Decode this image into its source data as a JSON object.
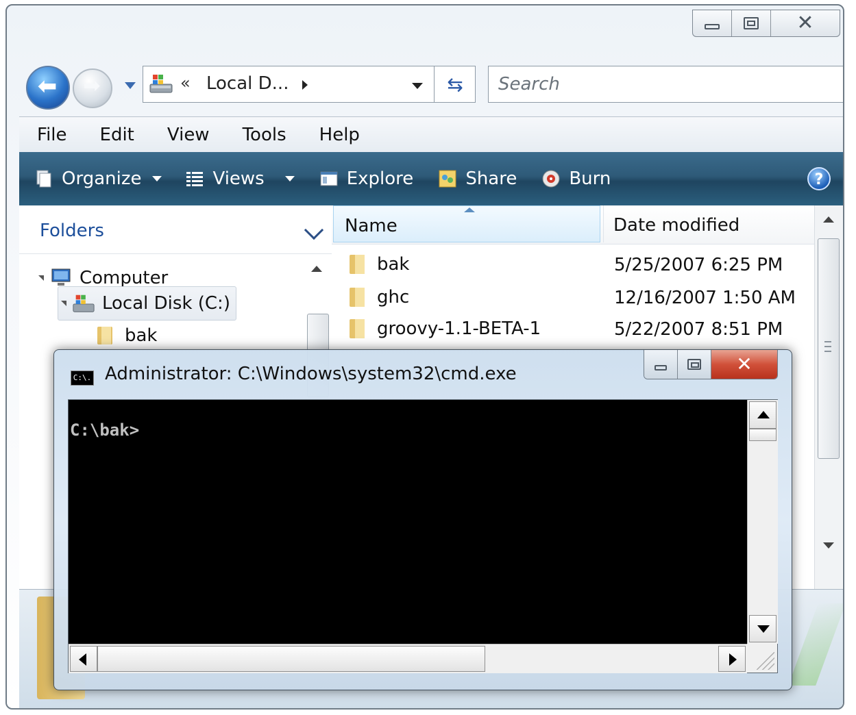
{
  "explorer": {
    "address": {
      "crumb": "Local D...",
      "prefix": "«"
    },
    "search": {
      "placeholder": "Search"
    },
    "menu": [
      "File",
      "Edit",
      "View",
      "Tools",
      "Help"
    ],
    "toolbar": {
      "organize": "Organize",
      "views": "Views",
      "explore": "Explore",
      "share": "Share",
      "burn": "Burn",
      "help": "?"
    },
    "nav": {
      "header": "Folders",
      "tree": [
        {
          "label": "Computer"
        },
        {
          "label": "Local Disk (C:)"
        },
        {
          "label": "bak"
        }
      ]
    },
    "files": {
      "columns": [
        "Name",
        "Date modified"
      ],
      "rows": [
        {
          "name": "bak",
          "date": "5/25/2007 6:25 PM"
        },
        {
          "name": "ghc",
          "date": "12/16/2007 1:50 AM"
        },
        {
          "name": "groovy-1.1-BETA-1",
          "date": "5/22/2007 8:51 PM"
        }
      ]
    }
  },
  "cmd": {
    "title": "Administrator: C:\\Windows\\system32\\cmd.exe",
    "icon_text": "C:\\.",
    "prompt": "C:\\bak>"
  },
  "colors": {
    "command_bar": "#2e5a78",
    "link_blue": "#1d4f9b",
    "console_bg": "#000000",
    "console_fg": "#c0c0c0",
    "close_red": "#c8412a"
  },
  "icons": [
    "back-arrow-icon",
    "forward-arrow-icon",
    "drive-icon",
    "refresh-icon",
    "organize-icon",
    "views-icon",
    "explore-icon",
    "share-icon",
    "burn-icon",
    "help-icon",
    "computer-icon",
    "folder-icon",
    "cmd-icon"
  ]
}
